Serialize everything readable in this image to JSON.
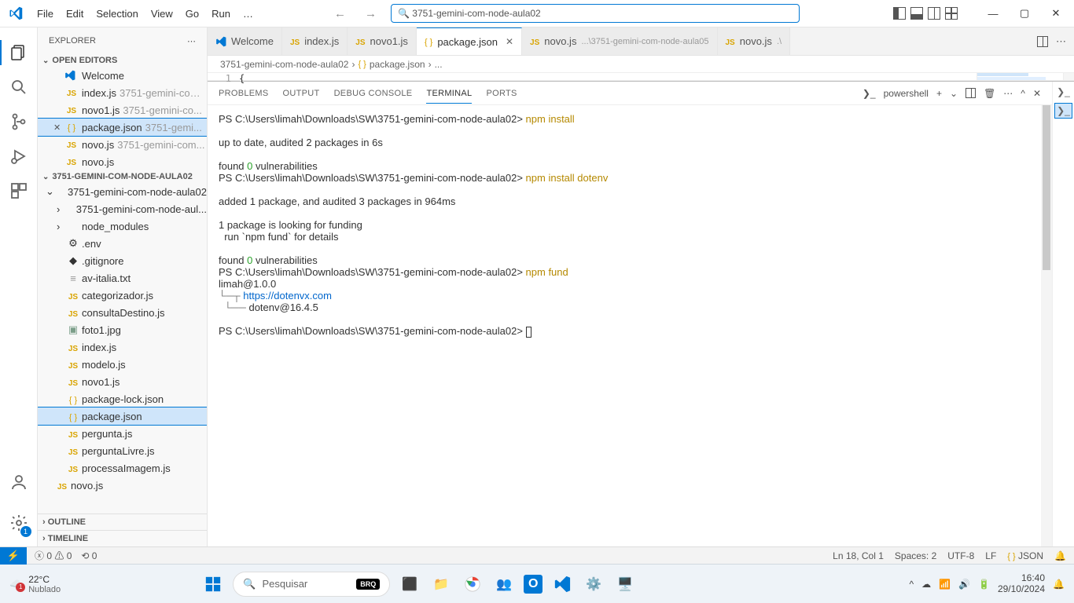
{
  "menubar": {
    "items": [
      "File",
      "Edit",
      "Selection",
      "View",
      "Go",
      "Run",
      "…"
    ]
  },
  "search": {
    "placeholder": "3751-gemini-com-node-aula02"
  },
  "window_controls": {
    "min": "—",
    "max": "▢",
    "close": "✕"
  },
  "activity": {
    "settings_badge": "1"
  },
  "explorer": {
    "title": "EXPLORER",
    "open_editors_label": "OPEN EDITORS",
    "open_editors": [
      {
        "icon": "vs",
        "label": "Welcome",
        "dim": ""
      },
      {
        "icon": "js",
        "label": "index.js",
        "dim": "3751-gemini-com..."
      },
      {
        "icon": "js",
        "label": "novo1.js",
        "dim": "3751-gemini-co..."
      },
      {
        "icon": "json",
        "label": "package.json",
        "dim": "3751-gemi...",
        "selected": true
      },
      {
        "icon": "js",
        "label": "novo.js",
        "dim": "3751-gemini-com..."
      },
      {
        "icon": "js",
        "label": "novo.js",
        "dim": ""
      }
    ],
    "root": "3751-GEMINI-COM-NODE-AULA02",
    "tree": [
      {
        "type": "folder",
        "open": true,
        "label": "3751-gemini-com-node-aula02",
        "indent": 0
      },
      {
        "type": "folder",
        "open": false,
        "label": "3751-gemini-com-node-aul...",
        "indent": 1
      },
      {
        "type": "folder",
        "open": false,
        "label": "node_modules",
        "indent": 1
      },
      {
        "type": "file",
        "icon": "gear",
        "label": ".env",
        "indent": 1
      },
      {
        "type": "file",
        "icon": "diamond",
        "label": ".gitignore",
        "indent": 1
      },
      {
        "type": "file",
        "icon": "txt",
        "label": "av-italia.txt",
        "indent": 1
      },
      {
        "type": "file",
        "icon": "js",
        "label": "categorizador.js",
        "indent": 1
      },
      {
        "type": "file",
        "icon": "js",
        "label": "consultaDestino.js",
        "indent": 1
      },
      {
        "type": "file",
        "icon": "img",
        "label": "foto1.jpg",
        "indent": 1
      },
      {
        "type": "file",
        "icon": "js",
        "label": "index.js",
        "indent": 1
      },
      {
        "type": "file",
        "icon": "js",
        "label": "modelo.js",
        "indent": 1
      },
      {
        "type": "file",
        "icon": "js",
        "label": "novo1.js",
        "indent": 1
      },
      {
        "type": "file",
        "icon": "json",
        "label": "package-lock.json",
        "indent": 1
      },
      {
        "type": "file",
        "icon": "json",
        "label": "package.json",
        "indent": 1,
        "selected": true
      },
      {
        "type": "file",
        "icon": "js",
        "label": "pergunta.js",
        "indent": 1
      },
      {
        "type": "file",
        "icon": "js",
        "label": "perguntaLivre.js",
        "indent": 1
      },
      {
        "type": "file",
        "icon": "js",
        "label": "processaImagem.js",
        "indent": 1
      },
      {
        "type": "file",
        "icon": "js",
        "label": "novo.js",
        "indent": 0
      }
    ],
    "outline": "OUTLINE",
    "timeline": "TIMELINE"
  },
  "tabs": [
    {
      "icon": "vs",
      "label": "Welcome"
    },
    {
      "icon": "js",
      "label": "index.js"
    },
    {
      "icon": "js",
      "label": "novo1.js"
    },
    {
      "icon": "json",
      "label": "package.json",
      "active": true,
      "close": true
    },
    {
      "icon": "js",
      "label": "novo.js",
      "dim": "...\\3751-gemini-com-node-aula05"
    },
    {
      "icon": "js",
      "label": "novo.js",
      "dim": ".\\"
    }
  ],
  "breadcrumb": {
    "a": "3751-gemini-com-node-aula02",
    "b": "package.json",
    "c": "..."
  },
  "editor": {
    "line_no": "1",
    "brace": "{"
  },
  "panel": {
    "tabs": [
      "PROBLEMS",
      "OUTPUT",
      "DEBUG CONSOLE",
      "TERMINAL",
      "PORTS"
    ],
    "active": 3,
    "shell": "powershell",
    "terminal_lines": [
      {
        "t": "PS C:\\Users\\limah\\Downloads\\SW\\3751-gemini-com-node-aula02> ",
        "cmd": "npm install"
      },
      {
        "t": ""
      },
      {
        "t": "up to date, audited 2 packages in 6s"
      },
      {
        "t": ""
      },
      {
        "t": "found ",
        "g": "0",
        "t2": " vulnerabilities"
      },
      {
        "t": "PS C:\\Users\\limah\\Downloads\\SW\\3751-gemini-com-node-aula02> ",
        "cmd": "npm install dotenv"
      },
      {
        "t": ""
      },
      {
        "t": "added 1 package, and audited 3 packages in 964ms"
      },
      {
        "t": ""
      },
      {
        "t": "1 package is looking for funding"
      },
      {
        "t": "  run `npm fund` for details"
      },
      {
        "t": ""
      },
      {
        "t": "found ",
        "g": "0",
        "t2": " vulnerabilities"
      },
      {
        "t": "PS C:\\Users\\limah\\Downloads\\SW\\3751-gemini-com-node-aula02> ",
        "cmd": "npm fund"
      },
      {
        "t": "limah@1.0.0"
      },
      {
        "pre": "└─┬ ",
        "link": "https://dotenvx.com"
      },
      {
        "pre": "  └── ",
        "t": "dotenv@16.4.5"
      },
      {
        "t": ""
      },
      {
        "t": "PS C:\\Users\\limah\\Downloads\\SW\\3751-gemini-com-node-aula02> ",
        "caret": true
      }
    ]
  },
  "statusbar": {
    "errors": "0",
    "warnings": "0",
    "port": "0",
    "cursor": "Ln 18, Col 1",
    "spaces": "Spaces: 2",
    "enc": "UTF-8",
    "eol": "LF",
    "lang": "JSON"
  },
  "taskbar": {
    "temp": "22°C",
    "cond": "Nublado",
    "search": "Pesquisar",
    "brand": "BRQ",
    "time": "16:40",
    "date": "29/10/2024"
  }
}
